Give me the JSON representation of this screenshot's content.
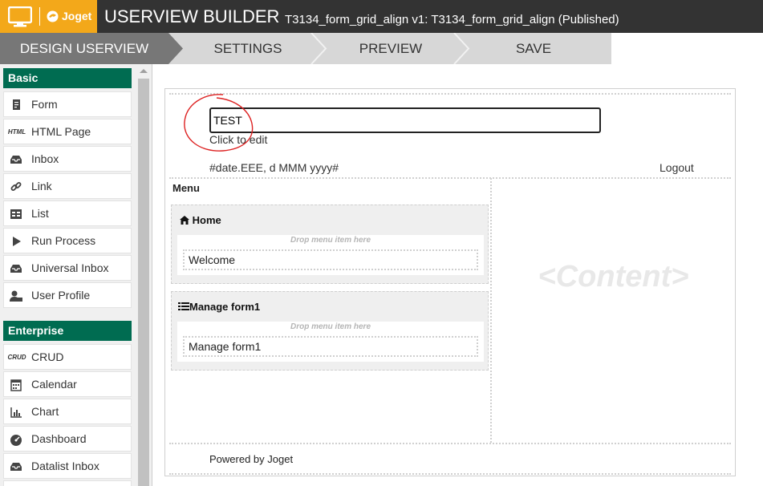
{
  "header": {
    "logo_text": "Joget",
    "title": "USERVIEW BUILDER",
    "subtitle": "T3134_form_grid_align v1: T3134_form_grid_align (Published)",
    "colors": {
      "bar": "#333333",
      "logo_bg": "#f3a81a"
    }
  },
  "steps": [
    {
      "label": "DESIGN USERVIEW",
      "active": true
    },
    {
      "label": "SETTINGS",
      "active": false
    },
    {
      "label": "PREVIEW",
      "active": false
    },
    {
      "label": "SAVE",
      "active": false
    }
  ],
  "sidebar": {
    "sections": [
      {
        "title": "Basic",
        "items": [
          {
            "label": "Form",
            "icon": "form-icon"
          },
          {
            "label": "HTML Page",
            "icon": "html-icon",
            "icon_text": "HTML"
          },
          {
            "label": "Inbox",
            "icon": "inbox-icon"
          },
          {
            "label": "Link",
            "icon": "link-icon"
          },
          {
            "label": "List",
            "icon": "list-icon"
          },
          {
            "label": "Run Process",
            "icon": "play-icon"
          },
          {
            "label": "Universal Inbox",
            "icon": "inbox-icon"
          },
          {
            "label": "User Profile",
            "icon": "user-profile-icon"
          }
        ]
      },
      {
        "title": "Enterprise",
        "items": [
          {
            "label": "CRUD",
            "icon": "crud-icon",
            "icon_text": "CRUD"
          },
          {
            "label": "Calendar",
            "icon": "calendar-icon"
          },
          {
            "label": "Chart",
            "icon": "chart-icon"
          },
          {
            "label": "Dashboard",
            "icon": "dashboard-icon"
          },
          {
            "label": "Datalist Inbox",
            "icon": "inbox-icon"
          }
        ]
      }
    ],
    "section_color": "#006c51"
  },
  "canvas": {
    "title_value": "TEST",
    "click_to_edit": "Click to edit",
    "date_format": "#date.EEE, d MMM yyyy#",
    "logout": "Logout",
    "menu_label": "Menu",
    "categories": [
      {
        "title": "Home",
        "icon": "home-icon",
        "drop_hint": "Drop menu item here",
        "items": [
          "Welcome"
        ]
      },
      {
        "title": "Manage form1",
        "icon": "list-lines-icon",
        "drop_hint": "Drop menu item here",
        "items": [
          "Manage form1"
        ]
      }
    ],
    "content_placeholder": "<Content>",
    "footer": "Powered by Joget"
  }
}
